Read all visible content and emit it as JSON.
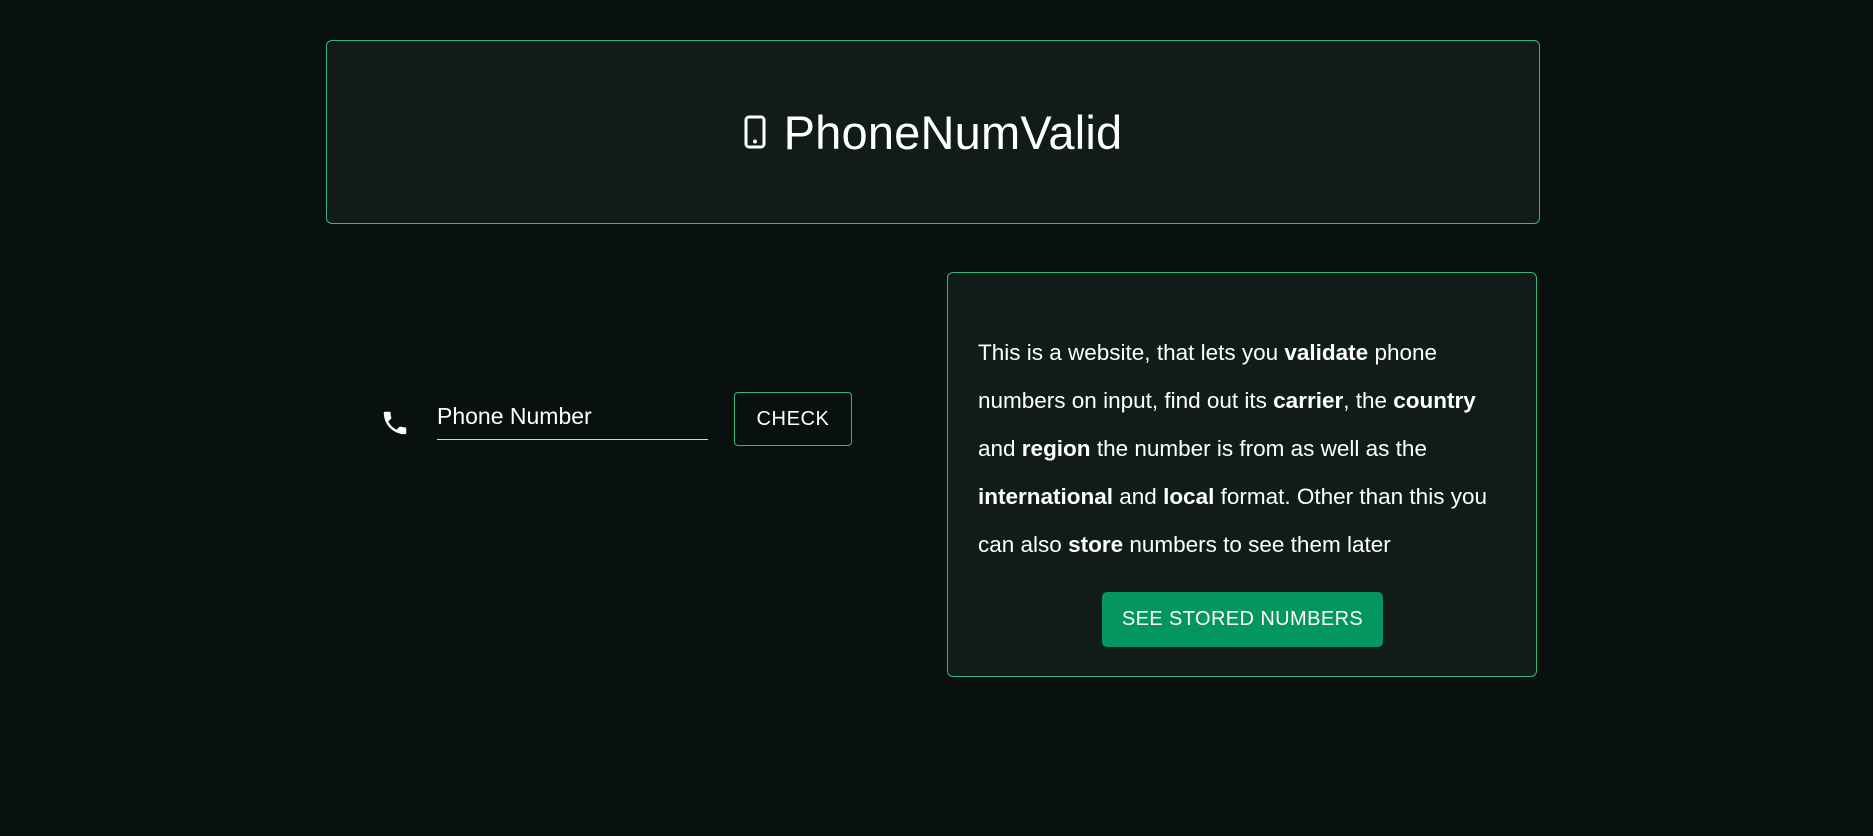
{
  "header": {
    "title": "PhoneNumValid",
    "icon": "smartphone-icon"
  },
  "form": {
    "icon": "phone-icon",
    "input_placeholder": "Phone Number",
    "input_value": "",
    "check_label": "CHECK"
  },
  "info": {
    "segments": [
      {
        "text": "This is a website, that lets you ",
        "bold": false
      },
      {
        "text": "validate",
        "bold": true
      },
      {
        "text": " phone numbers on input, find out its ",
        "bold": false
      },
      {
        "text": "carrier",
        "bold": true
      },
      {
        "text": ", the ",
        "bold": false
      },
      {
        "text": "country",
        "bold": true
      },
      {
        "text": " and ",
        "bold": false
      },
      {
        "text": "region",
        "bold": true
      },
      {
        "text": " the number is from as well as the ",
        "bold": false
      },
      {
        "text": "international",
        "bold": true
      },
      {
        "text": " and ",
        "bold": false
      },
      {
        "text": "local",
        "bold": true
      },
      {
        "text": " format. Other than this you can also ",
        "bold": false
      },
      {
        "text": "store",
        "bold": true
      },
      {
        "text": " numbers to see them later",
        "bold": false
      }
    ],
    "button_label": "SEE STORED NUMBERS"
  },
  "colors": {
    "background": "#081110",
    "card": "#111c1a",
    "accent_border": "#34b878",
    "primary_button": "#049660"
  }
}
